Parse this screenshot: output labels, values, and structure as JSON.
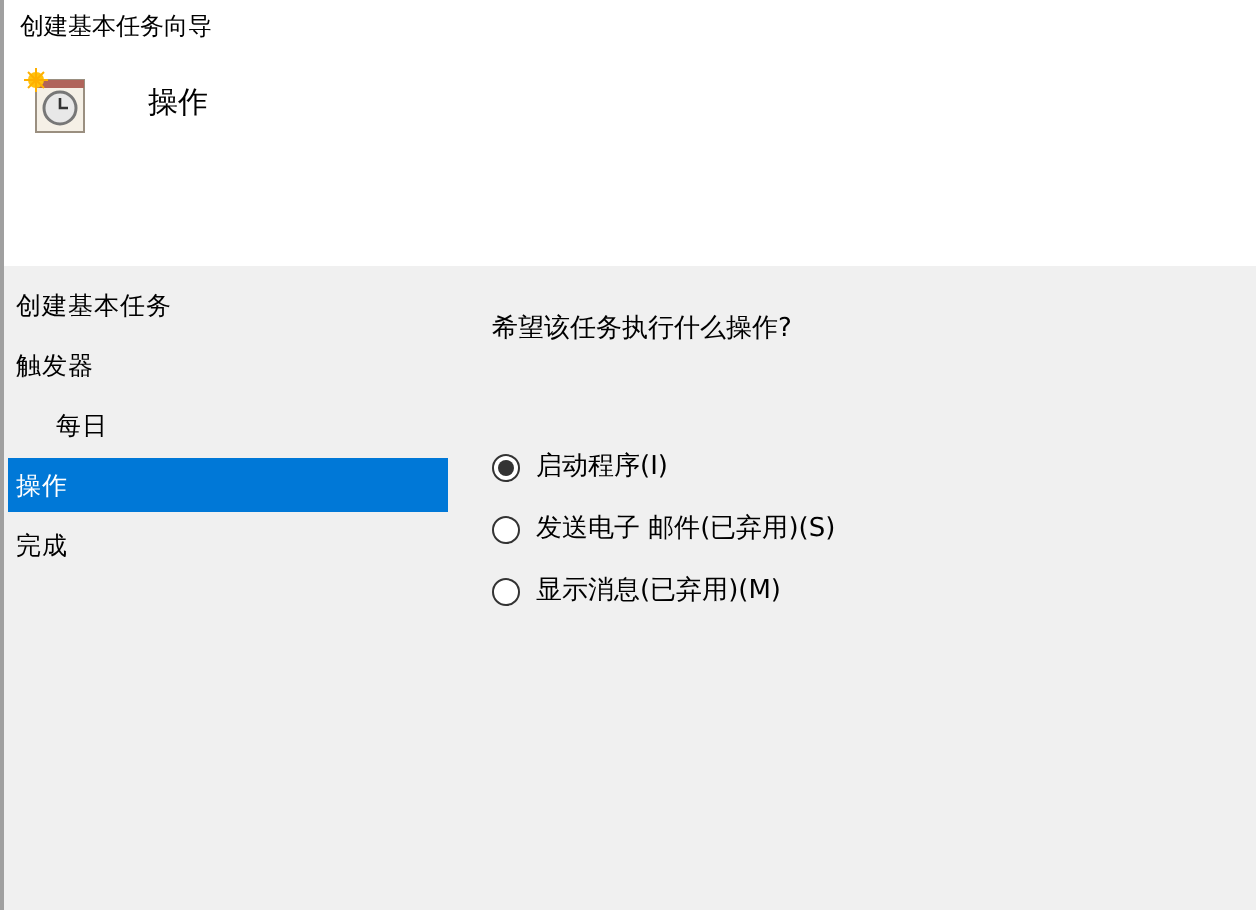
{
  "window": {
    "title": "创建基本任务向导"
  },
  "header": {
    "title": "操作"
  },
  "sidebar": {
    "items": [
      {
        "label": "创建基本任务",
        "selected": false
      },
      {
        "label": "触发器",
        "selected": false,
        "children": [
          {
            "label": "每日",
            "selected": false
          }
        ]
      },
      {
        "label": "操作",
        "selected": true
      },
      {
        "label": "完成",
        "selected": false
      }
    ]
  },
  "content": {
    "question": "希望该任务执行什么操作?",
    "options": [
      {
        "label": "启动程序(I)",
        "selected": true
      },
      {
        "label": "发送电子 邮件(已弃用)(S)",
        "selected": false
      },
      {
        "label": "显示消息(已弃用)(M)",
        "selected": false
      }
    ]
  }
}
